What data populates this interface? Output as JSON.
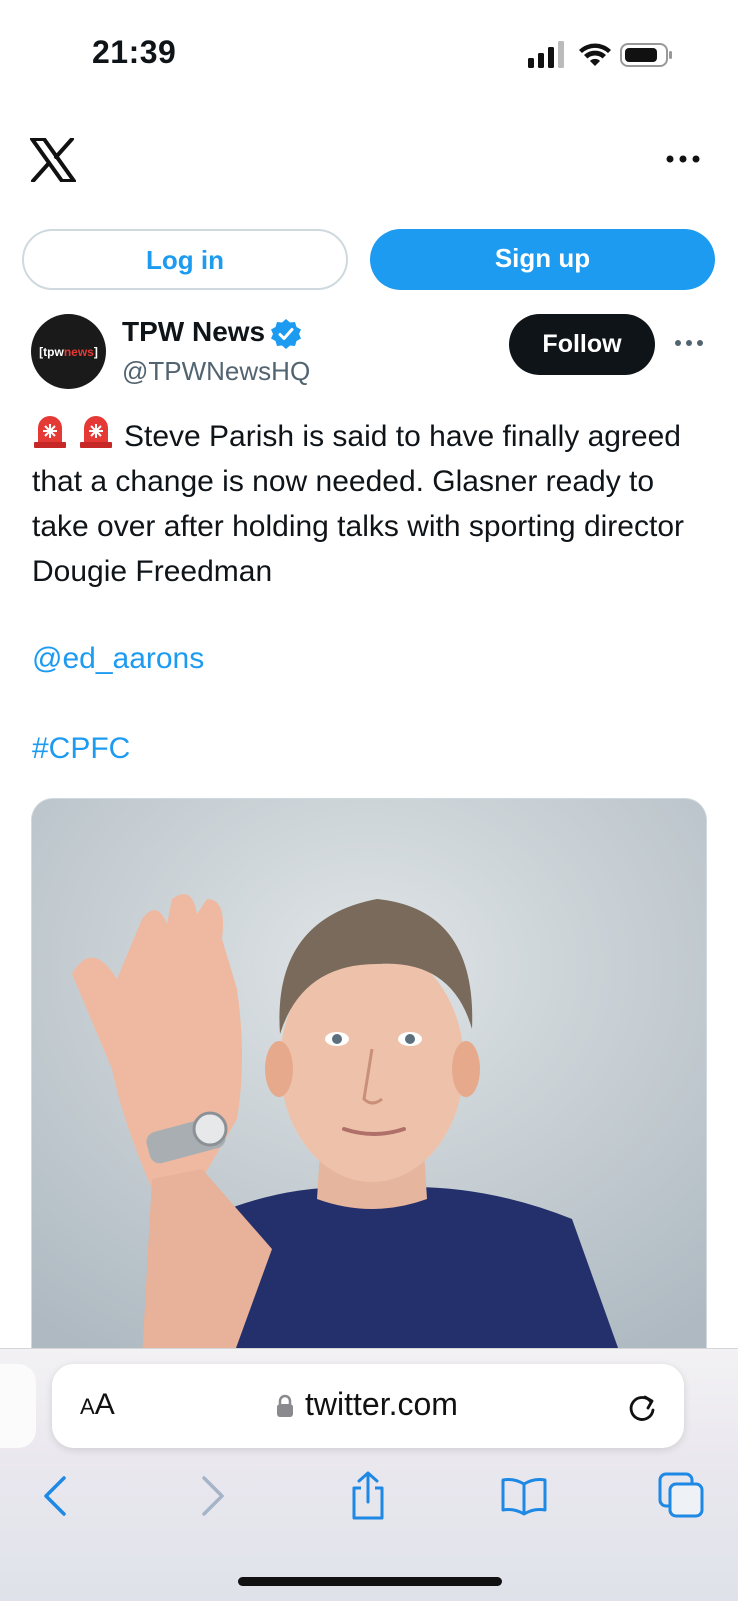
{
  "status_bar": {
    "time": "21:39"
  },
  "header": {
    "logo": "x-logo-icon",
    "more": "more-horizontal-icon"
  },
  "auth": {
    "login_label": "Log in",
    "signup_label": "Sign up"
  },
  "tweet": {
    "avatar_text_prefix": "[tpw",
    "avatar_text_red": "news",
    "avatar_text_suffix": "]",
    "display_name": "TPW News",
    "handle": "@TPWNewsHQ",
    "follow_label": "Follow",
    "text": "Steve Parish is said to have finally agreed that a change is now needed. Glasner ready to take over after holding talks with sporting director Dougie Freedman",
    "mention": "@ed_aarons",
    "hashtag": "#CPFC"
  },
  "browser": {
    "aa_label_small": "A",
    "aa_label_large": "A",
    "url": "twitter.com"
  },
  "colors": {
    "accent": "#1d9bf0",
    "follow_bg": "#0f1419",
    "siren": "#e53935"
  }
}
